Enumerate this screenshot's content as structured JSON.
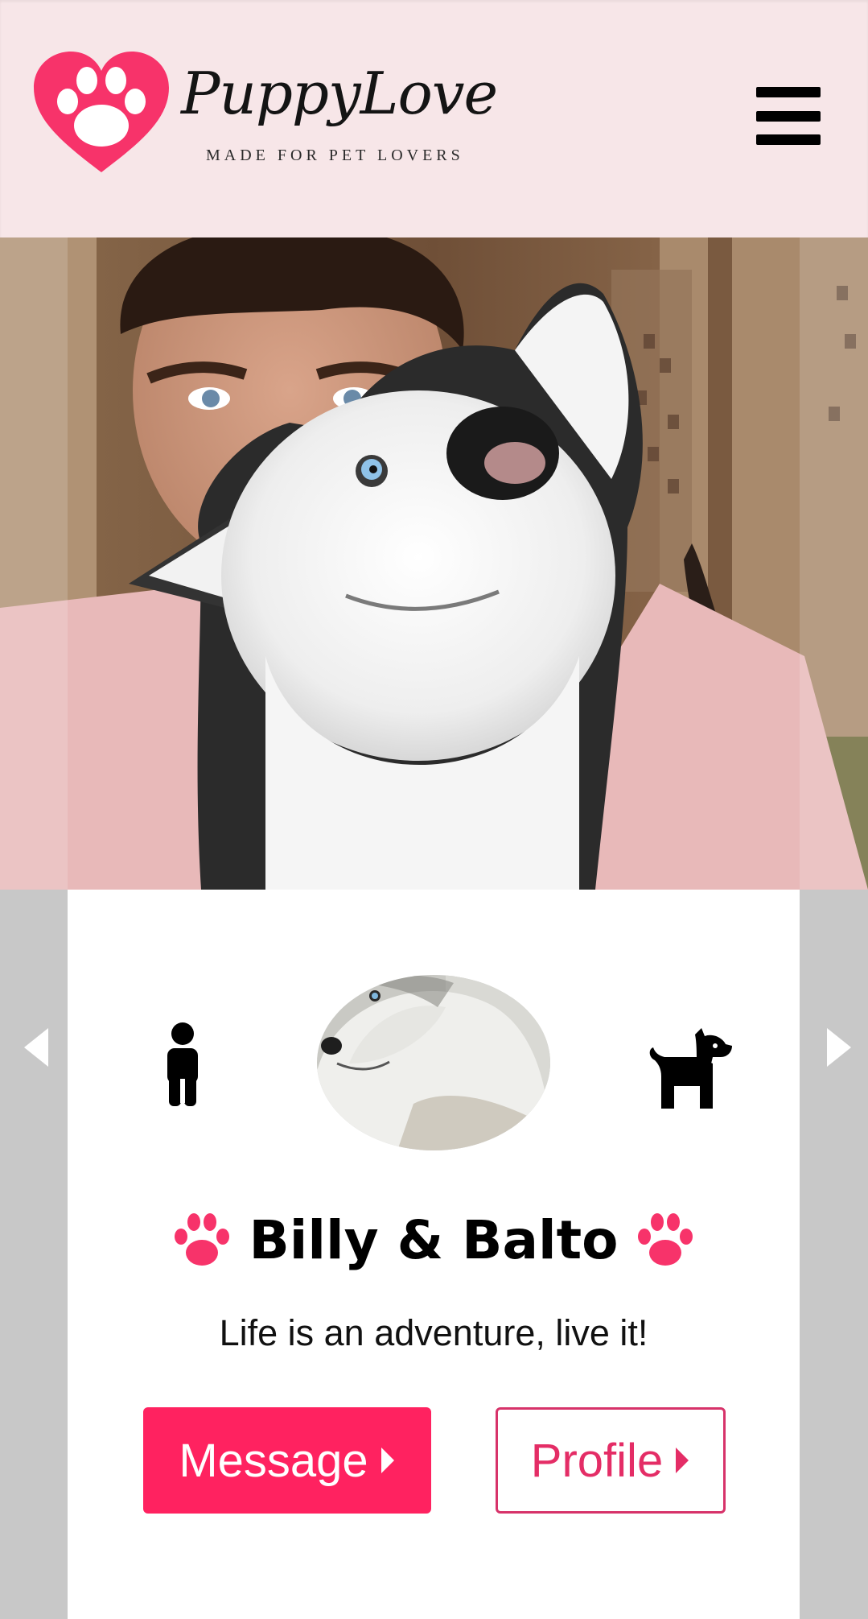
{
  "header": {
    "brand_name": "PuppyLove",
    "brand_tagline": "MADE FOR PET LOVERS",
    "menu_icon": "hamburger-menu-icon"
  },
  "hero": {
    "image": "photo of man holding husky dog"
  },
  "carousel": {
    "prev_icon": "triangle-left-icon",
    "next_icon": "triangle-right-icon"
  },
  "card": {
    "owner_icon": "person-icon",
    "pet_icon": "dog-icon",
    "avatar": "husky avatar",
    "name": "Billy & Balto",
    "name_icon": "paw-icon",
    "bio": "Life is an adventure, live it!",
    "message_button": "Message",
    "profile_button": "Profile",
    "button_icon": "caret-right-icon"
  },
  "colors": {
    "accent": "#ff2260",
    "header_bg": "#f7e6e8",
    "side_bg": "#c8c8c8",
    "card_bg": "#ffffff",
    "outline": "#d7336a"
  }
}
